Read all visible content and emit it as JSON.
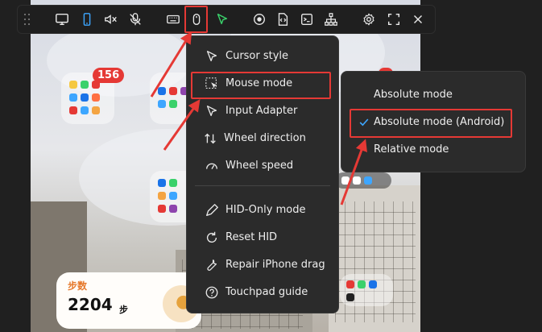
{
  "toolbar": {
    "icons": [
      "grip-icon",
      "monitor-icon",
      "phone-icon",
      "mute-icon",
      "mic-off-icon",
      "keyboard-icon",
      "mouse-icon",
      "cursor-icon",
      "record-icon",
      "file-icon",
      "terminal-icon",
      "network-icon",
      "gear-icon",
      "fullscreen-icon",
      "close-icon"
    ],
    "colors": {
      "background": "#1f1f1f",
      "active_phone": "#3da6ff",
      "cursor": "#3ad16b",
      "highlight": "#e53935"
    }
  },
  "mouse_menu": {
    "items": [
      {
        "label": "Cursor style",
        "icon": "cursor-icon"
      },
      {
        "label": "Mouse mode",
        "icon": "mouse-mode-icon"
      },
      {
        "label": "Input Adapter",
        "icon": "pointer-icon"
      },
      {
        "label": "Wheel direction",
        "icon": "updown-icon"
      },
      {
        "label": "Wheel speed",
        "icon": "speed-icon"
      },
      {
        "label": "HID-Only mode",
        "icon": "pen-icon"
      },
      {
        "label": "Reset HID",
        "icon": "refresh-icon"
      },
      {
        "label": "Repair iPhone drag",
        "icon": "wrench-icon"
      },
      {
        "label": "Touchpad guide",
        "icon": "help-icon"
      }
    ]
  },
  "mode_submenu": {
    "items": [
      {
        "label": "Absolute mode",
        "checked": false
      },
      {
        "label": "Absolute mode (Android)",
        "checked": true
      },
      {
        "label": "Relative mode",
        "checked": false
      }
    ]
  },
  "phone": {
    "badge_count": "156",
    "steps_label": "步数",
    "steps_value": "2204",
    "steps_unit": "步"
  }
}
